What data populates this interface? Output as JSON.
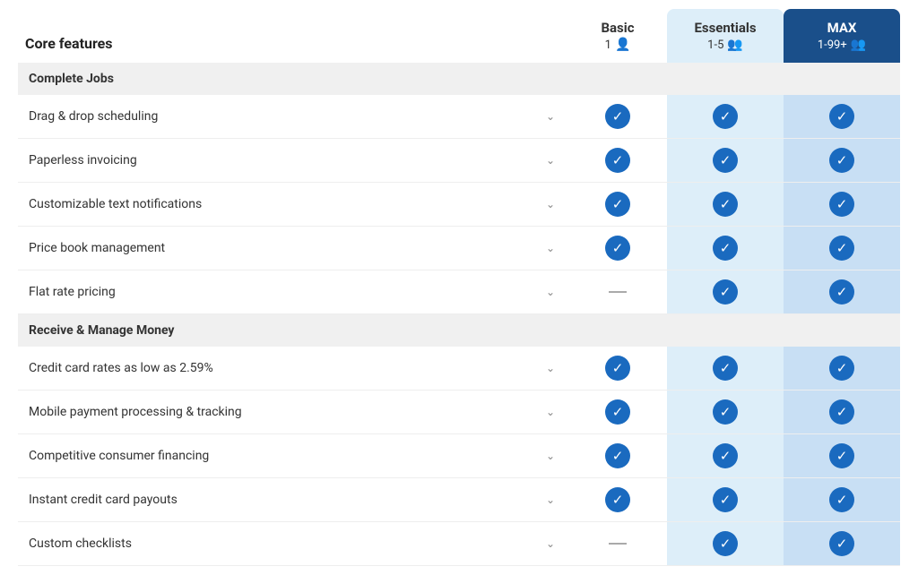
{
  "header": {
    "feature_col_label": "Core features",
    "basic": {
      "label": "Basic",
      "sub": "1",
      "icon": "👤"
    },
    "essentials": {
      "label": "Essentials",
      "sub": "1-5",
      "icon": "👥"
    },
    "max": {
      "label": "MAX",
      "sub": "1-99+",
      "icon": "👥"
    }
  },
  "sections": [
    {
      "name": "Complete Jobs",
      "features": [
        {
          "label": "Drag & drop scheduling",
          "basic": "check",
          "essentials": "check",
          "max": "check"
        },
        {
          "label": "Paperless invoicing",
          "basic": "check",
          "essentials": "check",
          "max": "check"
        },
        {
          "label": "Customizable text notifications",
          "basic": "check",
          "essentials": "check",
          "max": "check"
        },
        {
          "label": "Price book management",
          "basic": "check",
          "essentials": "check",
          "max": "check"
        },
        {
          "label": "Flat rate pricing",
          "basic": "dash",
          "essentials": "check",
          "max": "check"
        }
      ]
    },
    {
      "name": "Receive & Manage Money",
      "features": [
        {
          "label": "Credit card rates as low as 2.59%",
          "basic": "check",
          "essentials": "check",
          "max": "check"
        },
        {
          "label": "Mobile payment processing & tracking",
          "basic": "check",
          "essentials": "check",
          "max": "check"
        },
        {
          "label": "Competitive consumer financing",
          "basic": "check",
          "essentials": "check",
          "max": "check"
        },
        {
          "label": "Instant credit card payouts",
          "basic": "check",
          "essentials": "check",
          "max": "check"
        },
        {
          "label": "Custom checklists",
          "basic": "dash",
          "essentials": "check",
          "max": "check"
        }
      ]
    }
  ]
}
